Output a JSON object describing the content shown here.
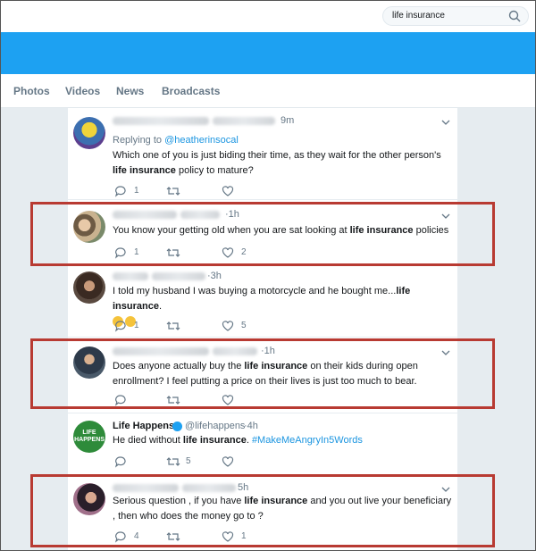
{
  "search": {
    "query": "life insurance"
  },
  "tabs": [
    "Photos",
    "Videos",
    "News",
    "Broadcasts"
  ],
  "tweets": [
    {
      "time": "9m",
      "reply_prefix": "Replying to ",
      "reply_handle": "@heatherinsocal",
      "text_a": "Which one of you is just biding their time, as they wait for the other person's ",
      "text_b": "life insurance",
      "text_c": " policy to mature?",
      "replies": "1",
      "retweets": "",
      "likes": ""
    },
    {
      "time": "·1h",
      "text_a": "You know your getting old when you are sat looking at ",
      "text_b": "life insurance",
      "text_c": " policies",
      "replies": "1",
      "retweets": "",
      "likes": "2"
    },
    {
      "time": "·3h",
      "text_a": "I told my husband I was buying a motorcycle and he bought me...",
      "text_b": "life insurance",
      "text_c": ".",
      "replies": "1",
      "retweets": "",
      "likes": "5"
    },
    {
      "time": "·1h",
      "text_a": "Does anyone actually buy the ",
      "text_b": "life insurance",
      "text_c": " on their kids during open enrollment? I feel putting a price on their lives is just too much to bear.",
      "replies": "",
      "retweets": "",
      "likes": ""
    },
    {
      "name": "Life Happens",
      "handle": "@lifehappens",
      "time": "·4h",
      "logo_line1": "LIFE",
      "logo_line2": "HAPPENS",
      "text_a": "He died without ",
      "text_b": "life insurance",
      "text_c": ". ",
      "hashtag": "#MakeMeAngryIn5Words",
      "replies": "",
      "retweets": "5",
      "likes": ""
    },
    {
      "time": "5h",
      "text_a": "Serious question , if you have ",
      "text_b": "life insurance",
      "text_c": " and you out live your beneficiary , then who does the money go to ?",
      "replies": "4",
      "retweets": "",
      "likes": "1"
    }
  ],
  "colors": {
    "highlight": "#b83a32",
    "twitter_blue": "#1da1f2"
  }
}
